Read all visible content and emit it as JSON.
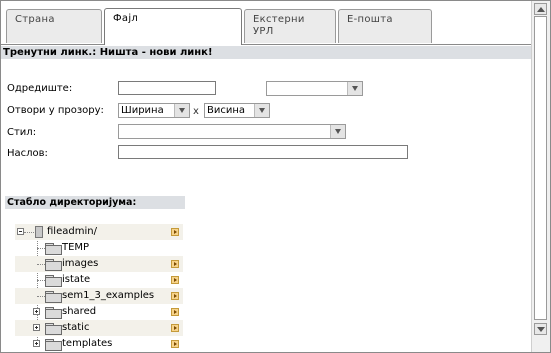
{
  "tabs": [
    {
      "label": "Страна",
      "active": false
    },
    {
      "label": "Фајл",
      "active": true
    },
    {
      "label": "Екстерни\nУРЛ",
      "active": false
    },
    {
      "label": "Е-пошта",
      "active": false
    }
  ],
  "current_link": "Тренутни линк.: Ништа - нови линк!",
  "form": {
    "target_label": "Одредиште:",
    "target_value": "",
    "target_select": "",
    "window_label": "Отвори у прозору:",
    "width_select": "Ширина",
    "times": "x",
    "height_select": "Висина",
    "style_label": "Стил:",
    "style_select": "",
    "title_label": "Наслов:",
    "title_value": ""
  },
  "tree": {
    "heading": "Стабло директоријума:",
    "root": "fileadmin/",
    "items": [
      {
        "name": "TEMP",
        "expander": false
      },
      {
        "name": "images",
        "expander": false
      },
      {
        "name": "istate",
        "expander": false
      },
      {
        "name": "sem1_3_examples",
        "expander": false
      },
      {
        "name": "shared",
        "expander": true
      },
      {
        "name": "static",
        "expander": true
      },
      {
        "name": "templates",
        "expander": true
      }
    ]
  },
  "icons": {
    "folder": "folder-icon",
    "drive": "drive-icon",
    "go": "arrow-right-icon",
    "expand": "plus-icon",
    "collapse": "minus-icon"
  }
}
